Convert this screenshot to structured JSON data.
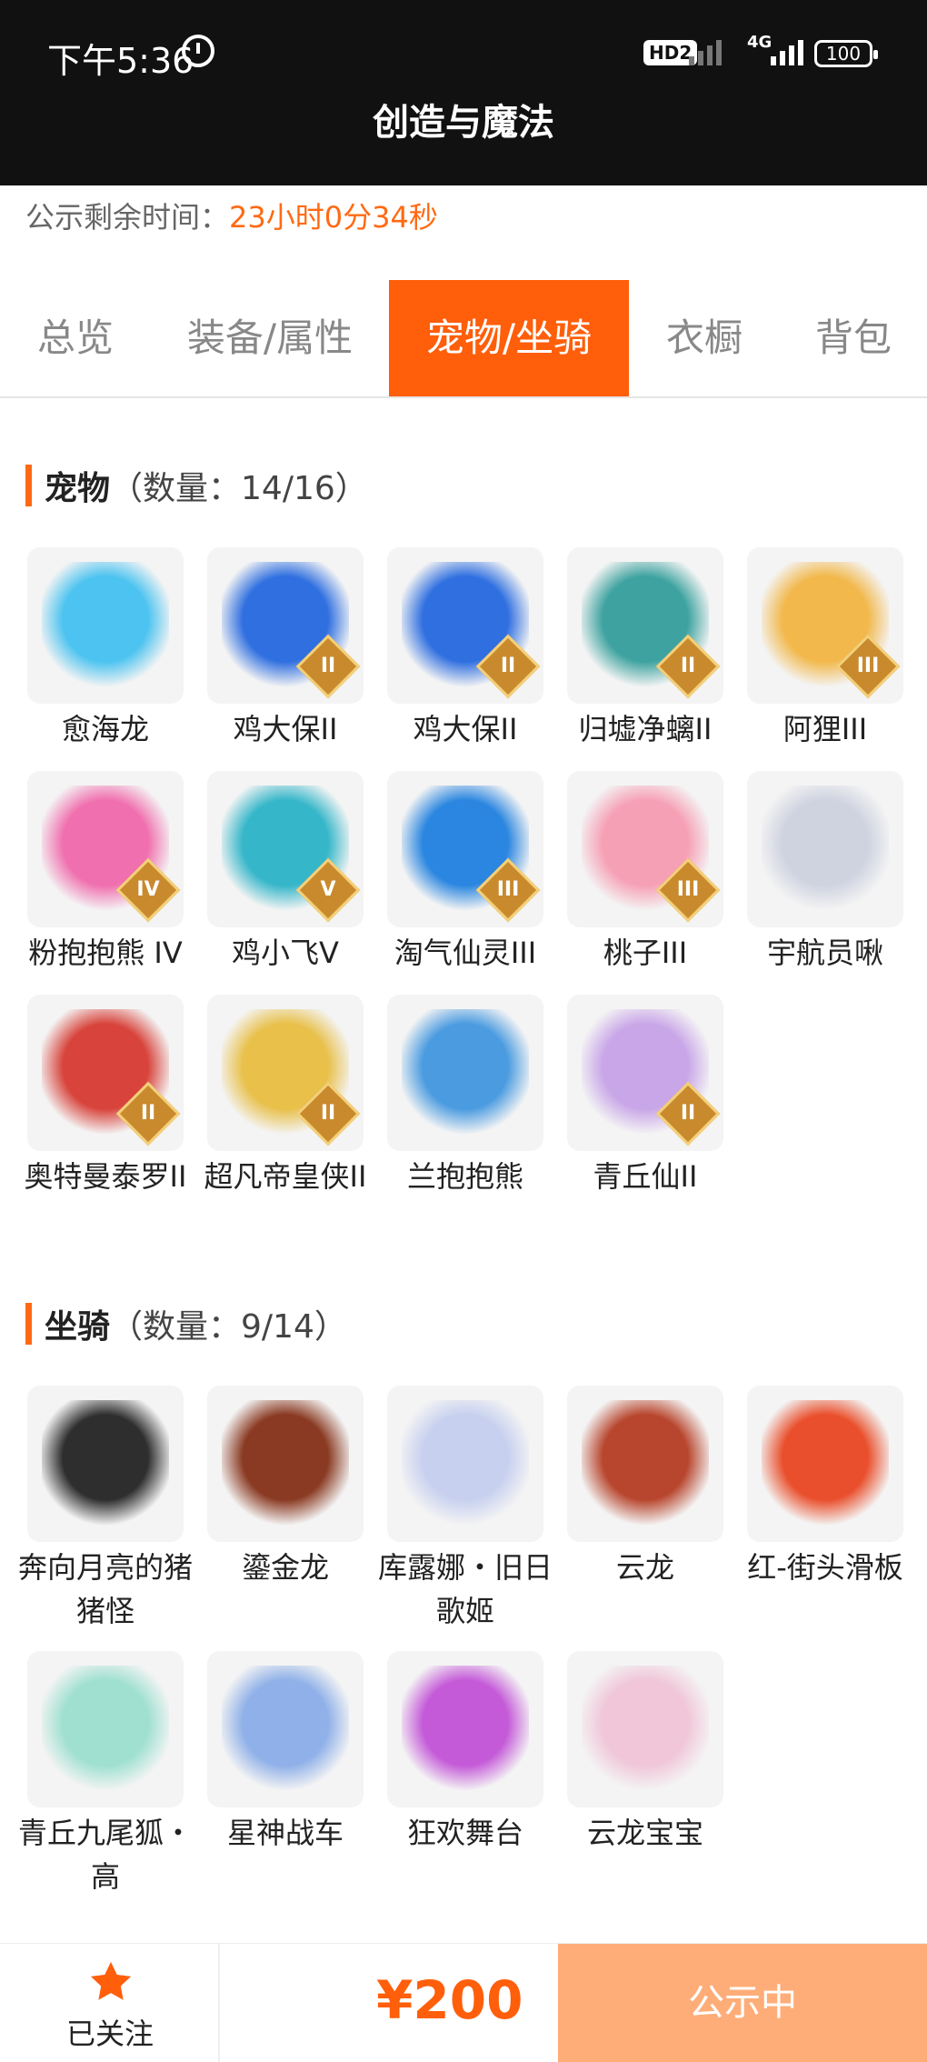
{
  "status_bar": {
    "time": "下午5:36",
    "hd_badge": "HD2",
    "network": "4G",
    "battery": "100"
  },
  "header": {
    "title": "创造与魔法"
  },
  "notice": {
    "label": "公示剩余时间：",
    "remaining": "23小时0分34秒"
  },
  "tabs": [
    {
      "label": "总览",
      "active": false
    },
    {
      "label": "装备/属性",
      "active": false
    },
    {
      "label": "宠物/坐骑",
      "active": true
    },
    {
      "label": "衣橱",
      "active": false
    },
    {
      "label": "背包",
      "active": false
    }
  ],
  "pets": {
    "title": "宠物",
    "count": "（数量：14/16）",
    "items": [
      {
        "label": "愈海龙",
        "grade": "",
        "color": "#4cc3f0"
      },
      {
        "label": "鸡大保II",
        "grade": "II",
        "color": "#2f6fe0"
      },
      {
        "label": "鸡大保II",
        "grade": "II",
        "color": "#2f6fe0"
      },
      {
        "label": "归墟净螭II",
        "grade": "II",
        "color": "#3ea3a0"
      },
      {
        "label": "阿狸III",
        "grade": "III",
        "color": "#f2b84b"
      },
      {
        "label": "粉抱抱熊 IV",
        "grade": "IV",
        "color": "#f06fae"
      },
      {
        "label": "鸡小飞V",
        "grade": "V",
        "color": "#35b6c9"
      },
      {
        "label": "淘气仙灵III",
        "grade": "III",
        "color": "#2a86e0"
      },
      {
        "label": "桃子III",
        "grade": "III",
        "color": "#f6a0b5"
      },
      {
        "label": "宇航员啾",
        "grade": "",
        "color": "#cfd3e0"
      },
      {
        "label": "奥特曼泰罗II",
        "grade": "II",
        "color": "#d8443c"
      },
      {
        "label": "超凡帝皇侠II",
        "grade": "II",
        "color": "#e8c04a"
      },
      {
        "label": "兰抱抱熊",
        "grade": "",
        "color": "#4a9be0"
      },
      {
        "label": "青丘仙II",
        "grade": "II",
        "color": "#c9a6e8"
      }
    ]
  },
  "mounts": {
    "title": "坐骑",
    "count": "（数量：9/14）",
    "items": [
      {
        "label": "奔向月亮的猪猪怪",
        "color": "#2e2e2e"
      },
      {
        "label": "鎏金龙",
        "color": "#8a3a22"
      },
      {
        "label": "库露娜・旧日歌姬",
        "color": "#c7d0ef"
      },
      {
        "label": "云龙",
        "color": "#b8462e"
      },
      {
        "label": "红-街头滑板",
        "color": "#e94f2c"
      },
      {
        "label": "青丘九尾狐・高",
        "color": "#9fe0d0"
      },
      {
        "label": "星神战车",
        "color": "#8fb0e8"
      },
      {
        "label": "狂欢舞台",
        "color": "#c45ad8"
      },
      {
        "label": "云龙宝宝",
        "color": "#f0c6d8"
      }
    ]
  },
  "bottom": {
    "follow_label": "已关注",
    "price": "¥200",
    "status": "公示中",
    "accent": "#ff5e0a"
  }
}
